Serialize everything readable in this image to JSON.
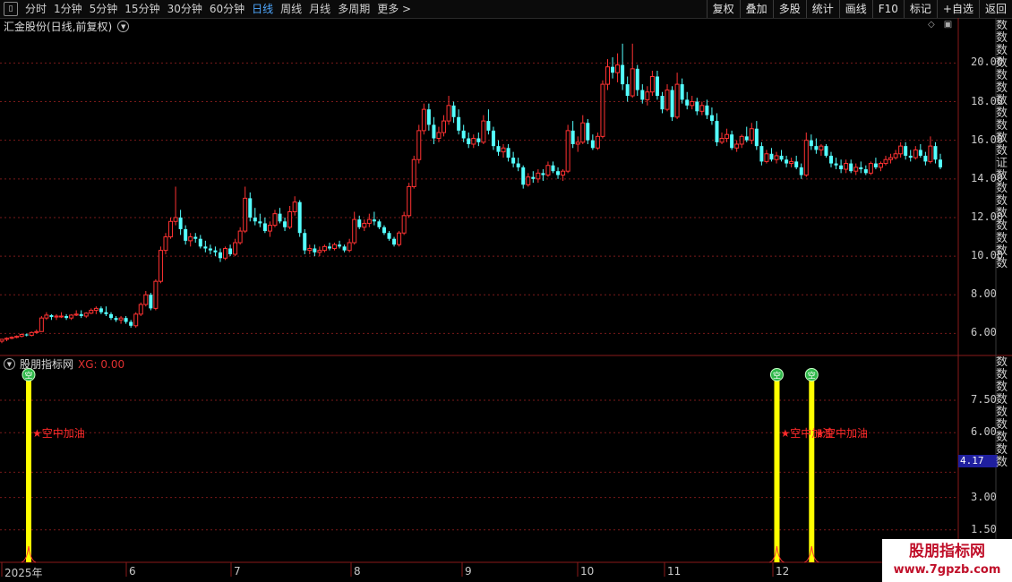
{
  "toolbar": {
    "periods": [
      "分时",
      "1分钟",
      "5分钟",
      "15分钟",
      "30分钟",
      "60分钟",
      "日线",
      "周线",
      "月线",
      "多周期",
      "更多 >"
    ],
    "active_period": "日线",
    "right_buttons": [
      "复权",
      "叠加",
      "多股",
      "统计",
      "画线",
      "F10",
      "标记",
      "+自选",
      "返回"
    ]
  },
  "main_chart": {
    "title": "汇金股份(日线,前复权)",
    "y_ticks": [
      "20.00",
      "18.00",
      "16.00",
      "14.00",
      "12.00",
      "10.00",
      "8.00",
      "6.00"
    ],
    "right_strip_text": "数数数数数数数数数数数证数数数数数数数数"
  },
  "indicator": {
    "name": "股朋指标网",
    "xg_text": "XG: 0.00",
    "y_ticks": [
      "7.50",
      "6.00",
      "3.00",
      "1.50"
    ],
    "highlight_value": "4.17",
    "signal_text": "★空中加油",
    "signal_icon": "空",
    "right_strip_text": "数数数数数数数数数"
  },
  "date_axis": [
    "2025年",
    "6",
    "7",
    "8",
    "9",
    "10",
    "11",
    "12"
  ],
  "watermark": {
    "title": "股朋指标网",
    "url": "www.7gpzb.com"
  },
  "colors": {
    "up": "#ff3232",
    "down": "#54ffff",
    "signal_bar": "#ffff00",
    "grid": "#7a1a1a"
  },
  "chart_data": {
    "type": "candlestick",
    "ylim": [
      5.0,
      21.5
    ],
    "candles": [
      [
        5.6,
        5.7,
        5.5,
        5.7
      ],
      [
        5.7,
        5.8,
        5.6,
        5.75
      ],
      [
        5.75,
        5.85,
        5.7,
        5.8
      ],
      [
        5.8,
        5.9,
        5.75,
        5.85
      ],
      [
        5.85,
        6.0,
        5.8,
        5.95
      ],
      [
        5.95,
        6.0,
        5.85,
        5.9
      ],
      [
        5.9,
        6.1,
        5.85,
        6.05
      ],
      [
        6.05,
        6.2,
        6.0,
        6.1
      ],
      [
        6.1,
        6.9,
        6.1,
        6.8
      ],
      [
        6.8,
        7.1,
        6.7,
        6.95
      ],
      [
        6.95,
        7.0,
        6.7,
        6.85
      ],
      [
        6.85,
        7.0,
        6.7,
        6.9
      ],
      [
        6.9,
        7.1,
        6.8,
        6.9
      ],
      [
        6.9,
        7.0,
        6.7,
        6.8
      ],
      [
        6.8,
        7.0,
        6.7,
        6.95
      ],
      [
        6.95,
        7.2,
        6.9,
        7.0
      ],
      [
        7.0,
        7.2,
        6.8,
        6.9
      ],
      [
        6.9,
        7.1,
        6.8,
        7.05
      ],
      [
        7.05,
        7.3,
        7.0,
        7.2
      ],
      [
        7.2,
        7.4,
        7.0,
        7.3
      ],
      [
        7.3,
        7.4,
        7.0,
        7.1
      ],
      [
        7.1,
        7.4,
        6.9,
        7.0
      ],
      [
        7.0,
        7.1,
        6.7,
        6.8
      ],
      [
        6.8,
        6.9,
        6.6,
        6.7
      ],
      [
        6.7,
        6.9,
        6.5,
        6.8
      ],
      [
        6.8,
        6.9,
        6.5,
        6.6
      ],
      [
        6.6,
        6.7,
        6.3,
        6.4
      ],
      [
        6.4,
        7.1,
        6.3,
        7.0
      ],
      [
        7.0,
        7.6,
        6.9,
        7.5
      ],
      [
        7.5,
        8.2,
        7.4,
        8.0
      ],
      [
        8.0,
        8.1,
        7.2,
        7.3
      ],
      [
        7.3,
        8.8,
        7.2,
        8.7
      ],
      [
        8.7,
        10.5,
        8.6,
        10.3
      ],
      [
        10.3,
        11.2,
        10.1,
        11.0
      ],
      [
        11.0,
        12.0,
        10.9,
        11.8
      ],
      [
        11.8,
        13.6,
        11.6,
        12.0
      ],
      [
        12.0,
        12.4,
        11.1,
        11.4
      ],
      [
        11.4,
        11.6,
        10.6,
        10.8
      ],
      [
        10.8,
        11.2,
        10.5,
        11.0
      ],
      [
        11.0,
        11.2,
        10.7,
        10.9
      ],
      [
        10.9,
        11.1,
        10.4,
        10.5
      ],
      [
        10.5,
        10.8,
        10.2,
        10.4
      ],
      [
        10.4,
        10.6,
        10.1,
        10.3
      ],
      [
        10.3,
        10.5,
        10.0,
        10.2
      ],
      [
        10.2,
        10.4,
        9.7,
        9.9
      ],
      [
        9.9,
        10.5,
        9.8,
        10.4
      ],
      [
        10.4,
        10.6,
        10.0,
        10.1
      ],
      [
        10.1,
        10.9,
        10.0,
        10.7
      ],
      [
        10.7,
        11.5,
        10.6,
        11.3
      ],
      [
        11.3,
        13.6,
        11.2,
        13.0
      ],
      [
        13.0,
        13.3,
        11.8,
        12.0
      ],
      [
        12.0,
        12.5,
        11.6,
        11.8
      ],
      [
        11.8,
        12.2,
        11.5,
        11.7
      ],
      [
        11.7,
        12.0,
        11.2,
        11.3
      ],
      [
        11.3,
        11.8,
        11.0,
        11.6
      ],
      [
        11.6,
        12.4,
        11.5,
        12.2
      ],
      [
        12.2,
        12.5,
        11.7,
        11.8
      ],
      [
        11.8,
        12.0,
        11.3,
        11.5
      ],
      [
        11.5,
        12.6,
        11.4,
        12.3
      ],
      [
        12.3,
        13.1,
        12.1,
        12.8
      ],
      [
        12.8,
        12.9,
        11.0,
        11.2
      ],
      [
        11.2,
        11.4,
        10.1,
        10.3
      ],
      [
        10.3,
        10.6,
        10.1,
        10.4
      ],
      [
        10.4,
        10.6,
        10.0,
        10.2
      ],
      [
        10.2,
        10.5,
        10.0,
        10.3
      ],
      [
        10.3,
        10.6,
        10.2,
        10.5
      ],
      [
        10.5,
        10.7,
        10.3,
        10.4
      ],
      [
        10.4,
        10.7,
        10.3,
        10.6
      ],
      [
        10.6,
        10.8,
        10.4,
        10.5
      ],
      [
        10.5,
        10.6,
        10.2,
        10.3
      ],
      [
        10.3,
        10.9,
        10.2,
        10.7
      ],
      [
        10.7,
        12.3,
        10.6,
        11.9
      ],
      [
        11.9,
        12.1,
        11.4,
        11.5
      ],
      [
        11.5,
        11.9,
        11.3,
        11.7
      ],
      [
        11.7,
        12.2,
        11.5,
        11.9
      ],
      [
        11.9,
        12.3,
        11.6,
        11.8
      ],
      [
        11.8,
        11.9,
        11.4,
        11.5
      ],
      [
        11.5,
        11.6,
        11.1,
        11.2
      ],
      [
        11.2,
        11.3,
        10.8,
        10.9
      ],
      [
        10.9,
        11.0,
        10.5,
        10.6
      ],
      [
        10.6,
        11.3,
        10.5,
        11.2
      ],
      [
        11.2,
        12.3,
        11.1,
        12.1
      ],
      [
        12.1,
        13.8,
        12.0,
        13.6
      ],
      [
        13.6,
        15.2,
        13.5,
        15.0
      ],
      [
        15.0,
        16.8,
        14.8,
        16.5
      ],
      [
        16.5,
        17.9,
        16.3,
        17.6
      ],
      [
        17.6,
        17.9,
        16.5,
        16.8
      ],
      [
        16.8,
        17.2,
        15.8,
        16.1
      ],
      [
        16.1,
        16.7,
        15.9,
        16.4
      ],
      [
        16.4,
        17.3,
        16.2,
        17.0
      ],
      [
        17.0,
        18.3,
        16.8,
        17.8
      ],
      [
        17.8,
        18.0,
        16.9,
        17.2
      ],
      [
        17.2,
        17.6,
        16.3,
        16.5
      ],
      [
        16.5,
        16.8,
        15.9,
        16.1
      ],
      [
        16.1,
        16.4,
        15.6,
        15.8
      ],
      [
        15.8,
        16.3,
        15.6,
        16.1
      ],
      [
        16.1,
        16.4,
        15.7,
        15.9
      ],
      [
        15.9,
        17.3,
        15.8,
        17.0
      ],
      [
        17.0,
        17.6,
        16.3,
        16.5
      ],
      [
        16.5,
        16.7,
        15.5,
        15.7
      ],
      [
        15.7,
        16.0,
        15.2,
        15.4
      ],
      [
        15.4,
        15.8,
        15.1,
        15.6
      ],
      [
        15.6,
        15.8,
        14.9,
        15.1
      ],
      [
        15.1,
        15.4,
        14.6,
        14.8
      ],
      [
        14.8,
        15.1,
        14.4,
        14.6
      ],
      [
        14.6,
        14.7,
        13.5,
        13.7
      ],
      [
        13.7,
        14.3,
        13.6,
        14.1
      ],
      [
        14.1,
        14.4,
        13.8,
        14.0
      ],
      [
        14.0,
        14.5,
        13.8,
        14.3
      ],
      [
        14.3,
        14.5,
        13.9,
        14.2
      ],
      [
        14.2,
        14.9,
        14.1,
        14.7
      ],
      [
        14.7,
        14.9,
        14.3,
        14.4
      ],
      [
        14.4,
        14.6,
        14.0,
        14.2
      ],
      [
        14.2,
        14.5,
        13.9,
        14.4
      ],
      [
        14.4,
        16.8,
        14.3,
        16.5
      ],
      [
        16.5,
        17.0,
        15.6,
        15.8
      ],
      [
        15.8,
        16.2,
        15.4,
        15.9
      ],
      [
        15.9,
        17.3,
        15.8,
        16.9
      ],
      [
        16.9,
        17.1,
        15.8,
        16.0
      ],
      [
        16.0,
        16.3,
        15.5,
        15.6
      ],
      [
        15.6,
        16.4,
        15.5,
        16.2
      ],
      [
        16.2,
        19.1,
        16.1,
        18.9
      ],
      [
        18.9,
        20.2,
        18.6,
        19.8
      ],
      [
        19.8,
        20.3,
        19.2,
        19.5
      ],
      [
        19.5,
        20.5,
        19.0,
        19.9
      ],
      [
        19.9,
        21.0,
        18.6,
        18.9
      ],
      [
        18.9,
        19.3,
        18.0,
        18.3
      ],
      [
        18.3,
        21.0,
        18.2,
        19.7
      ],
      [
        19.7,
        19.9,
        18.3,
        18.6
      ],
      [
        18.6,
        18.9,
        17.9,
        18.1
      ],
      [
        18.1,
        18.8,
        17.8,
        18.5
      ],
      [
        18.5,
        19.6,
        18.3,
        19.3
      ],
      [
        19.3,
        19.6,
        18.1,
        18.3
      ],
      [
        18.3,
        18.5,
        17.4,
        17.6
      ],
      [
        17.6,
        18.9,
        17.5,
        18.6
      ],
      [
        18.6,
        18.8,
        17.0,
        17.2
      ],
      [
        17.2,
        19.5,
        17.1,
        18.9
      ],
      [
        18.9,
        19.2,
        17.9,
        18.1
      ],
      [
        18.1,
        18.5,
        17.6,
        17.8
      ],
      [
        17.8,
        18.3,
        17.6,
        18.0
      ],
      [
        18.0,
        18.2,
        17.3,
        17.5
      ],
      [
        17.5,
        18.0,
        17.3,
        17.8
      ],
      [
        17.8,
        18.1,
        17.1,
        17.3
      ],
      [
        17.3,
        17.7,
        16.8,
        17.0
      ],
      [
        17.0,
        17.4,
        15.7,
        15.9
      ],
      [
        15.9,
        16.4,
        15.8,
        16.1
      ],
      [
        16.1,
        16.6,
        15.9,
        16.3
      ],
      [
        16.3,
        16.5,
        15.5,
        15.6
      ],
      [
        15.6,
        16.0,
        15.4,
        15.8
      ],
      [
        15.8,
        16.3,
        15.6,
        16.2
      ],
      [
        16.2,
        16.7,
        15.9,
        16.0
      ],
      [
        16.0,
        16.9,
        15.8,
        16.6
      ],
      [
        16.6,
        17.0,
        15.5,
        15.7
      ],
      [
        15.7,
        15.9,
        14.7,
        14.9
      ],
      [
        14.9,
        15.5,
        14.8,
        15.3
      ],
      [
        15.3,
        15.6,
        14.9,
        15.0
      ],
      [
        15.0,
        15.4,
        14.8,
        15.2
      ],
      [
        15.2,
        15.5,
        14.9,
        15.0
      ],
      [
        15.0,
        15.2,
        14.6,
        14.8
      ],
      [
        14.8,
        15.1,
        14.6,
        14.9
      ],
      [
        14.9,
        15.2,
        14.5,
        14.6
      ],
      [
        14.6,
        14.8,
        14.0,
        14.2
      ],
      [
        14.2,
        16.4,
        14.1,
        16.0
      ],
      [
        16.0,
        16.3,
        15.5,
        15.7
      ],
      [
        15.7,
        16.1,
        15.3,
        15.5
      ],
      [
        15.5,
        15.8,
        15.2,
        15.7
      ],
      [
        15.7,
        15.8,
        15.1,
        15.2
      ],
      [
        15.2,
        15.4,
        14.6,
        14.8
      ],
      [
        14.8,
        15.1,
        14.5,
        14.7
      ],
      [
        14.7,
        15.0,
        14.3,
        14.5
      ],
      [
        14.5,
        15.0,
        14.3,
        14.8
      ],
      [
        14.8,
        15.0,
        14.3,
        14.4
      ],
      [
        14.4,
        14.8,
        14.2,
        14.6
      ],
      [
        14.6,
        14.9,
        14.3,
        14.5
      ],
      [
        14.5,
        14.7,
        14.2,
        14.3
      ],
      [
        14.3,
        14.9,
        14.2,
        14.8
      ],
      [
        14.8,
        15.1,
        14.5,
        14.6
      ],
      [
        14.6,
        14.9,
        14.4,
        14.8
      ],
      [
        14.8,
        15.2,
        14.7,
        15.0
      ],
      [
        15.0,
        15.3,
        14.8,
        15.1
      ],
      [
        15.1,
        15.5,
        15.0,
        15.3
      ],
      [
        15.3,
        15.9,
        15.1,
        15.7
      ],
      [
        15.7,
        15.9,
        15.0,
        15.2
      ],
      [
        15.2,
        15.5,
        14.9,
        15.1
      ],
      [
        15.1,
        15.7,
        15.0,
        15.5
      ],
      [
        15.5,
        15.8,
        15.1,
        15.2
      ],
      [
        15.2,
        15.4,
        14.7,
        14.9
      ],
      [
        14.9,
        16.2,
        14.8,
        15.7
      ],
      [
        15.7,
        15.9,
        14.8,
        15.0
      ],
      [
        15.0,
        15.3,
        14.5,
        14.6
      ]
    ],
    "signal_indices": [
      0,
      155,
      162
    ],
    "indicator_ylim": [
      0,
      9.2
    ],
    "signal_value": 8.6
  }
}
